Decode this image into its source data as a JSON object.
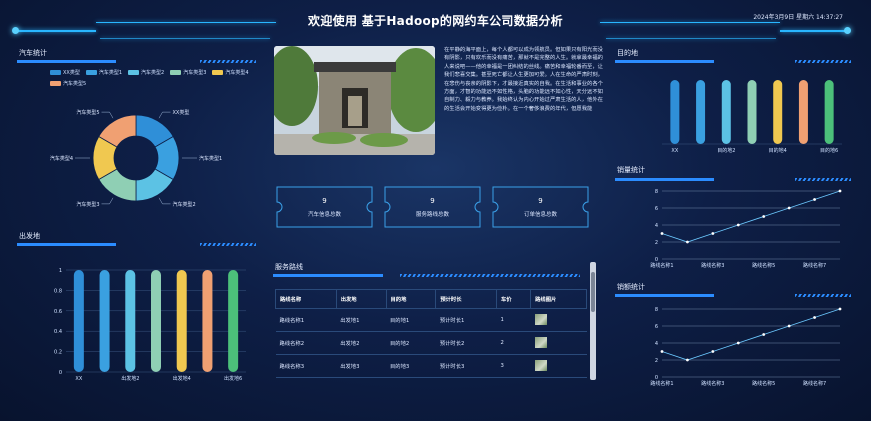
{
  "header": {
    "title": "欢迎使用 基于Hadoop的网约车公司数据分析",
    "datetime": "2024年3月9日 星期六 14:37:27"
  },
  "car_stats": {
    "title": "汽车统计",
    "chart_data": {
      "type": "pie",
      "labels": [
        "XX类型",
        "汽车类型1",
        "汽车类型2",
        "汽车类型3",
        "汽车类型4",
        "汽车类型5"
      ],
      "values": [
        1,
        1,
        1,
        1,
        1,
        1
      ],
      "colors": [
        "#2f8fd8",
        "#3aa0e0",
        "#5cc2e4",
        "#8fcfb4",
        "#f0c850",
        "#f0a072"
      ],
      "legend_placement": "top"
    }
  },
  "origin": {
    "title": "出发地",
    "chart_data": {
      "type": "bar",
      "categories": [
        "XX",
        "出发地1",
        "出发地2",
        "出发地3",
        "出发地4",
        "出发地5",
        "出发地6"
      ],
      "tick_labels": [
        "XX",
        "出发地2",
        "出发地4",
        "出发地6"
      ],
      "values": [
        1,
        1,
        1,
        1,
        1,
        1,
        1
      ],
      "ylim": [
        0,
        1
      ],
      "yticks": [
        "0",
        "0.2",
        "0.4",
        "0.6",
        "0.8",
        "1"
      ],
      "colors": [
        "#2f8fd8",
        "#3aa0e0",
        "#5cc2e4",
        "#8fcfb4",
        "#f0c850",
        "#f0a072",
        "#4cc07a"
      ]
    }
  },
  "destination": {
    "title": "目的地",
    "chart_data": {
      "type": "bar",
      "categories": [
        "XX",
        "目的地1",
        "目的地2",
        "目的地3",
        "目的地4",
        "目的地5",
        "目的地6"
      ],
      "tick_labels": [
        "XX",
        "目的地2",
        "目的地4",
        "目的地6"
      ],
      "values": [
        1,
        1,
        1,
        1,
        1,
        1,
        1
      ],
      "ylim": [
        0,
        1
      ],
      "colors": [
        "#2f8fd8",
        "#3aa0e0",
        "#5cc2e4",
        "#8fcfb4",
        "#f0c850",
        "#f0a072",
        "#4cc07a"
      ]
    }
  },
  "sales_stats": {
    "title": "销量统计",
    "chart_data": {
      "type": "line",
      "x": [
        "路线名称1",
        "路线名称2",
        "路线名称3",
        "路线名称4",
        "路线名称5",
        "路线名称6",
        "路线名称7",
        "路线名称8"
      ],
      "tick_labels": [
        "路线名称1",
        "路线名称3",
        "路线名称5",
        "路线名称7"
      ],
      "values": [
        3,
        2,
        3,
        4,
        5,
        6,
        7,
        8
      ],
      "ylim": [
        0,
        8
      ],
      "yticks": [
        "0",
        "2",
        "4",
        "6",
        "8"
      ]
    }
  },
  "revenue_stats": {
    "title": "销额统计",
    "chart_data": {
      "type": "line",
      "x": [
        "路线名称1",
        "路线名称2",
        "路线名称3",
        "路线名称4",
        "路线名称5",
        "路线名称6",
        "路线名称7",
        "路线名称8"
      ],
      "tick_labels": [
        "路线名称1",
        "路线名称3",
        "路线名称5",
        "路线名称7"
      ],
      "values": [
        3,
        2,
        3,
        4,
        5,
        6,
        7,
        8
      ],
      "ylim": [
        0,
        8
      ],
      "yticks": [
        "0",
        "2",
        "4",
        "6",
        "8"
      ]
    }
  },
  "article": {
    "text": "在平静的海平面上，每个人都可以成为领航员。但如果只有阳光而没有阴影，只有欢乐而没有痛苦，那就不是完整的人生。就拿最幸福的人来说吧——他的幸福是一团纠结的丝线。痛苦和幸福轮番而至，让我们悲喜交集。甚至死亡都让人生更加可爱。人在生命的严肃时刻，在悲伤与丧亲的阴影下，才最接近真实的自我。在生活和事业的各个方面，才智的功能远不如性格，头脑的功能远不如心性，天分远不如自制力、毅力与教养。我始终认为内心开始过严肃生活的人，他外在的生活会开始变得更为俭朴。在一个奢侈浪费的年代，但愿我能"
  },
  "stats": [
    {
      "value": "9",
      "label": "汽车信息总数"
    },
    {
      "value": "9",
      "label": "服务路线总数"
    },
    {
      "value": "9",
      "label": "订单信息总数"
    }
  ],
  "routes": {
    "title": "服务路线",
    "columns": [
      "路线名称",
      "出发地",
      "目的地",
      "预计时长",
      "车价",
      "路线图片"
    ],
    "rows": [
      [
        "路线名称1",
        "出发地1",
        "目的地1",
        "预计时长1",
        "1"
      ],
      [
        "路线名称2",
        "出发地2",
        "目的地2",
        "预计时长2",
        "2"
      ],
      [
        "路线名称3",
        "出发地3",
        "目的地3",
        "预计时长3",
        "3"
      ]
    ]
  }
}
